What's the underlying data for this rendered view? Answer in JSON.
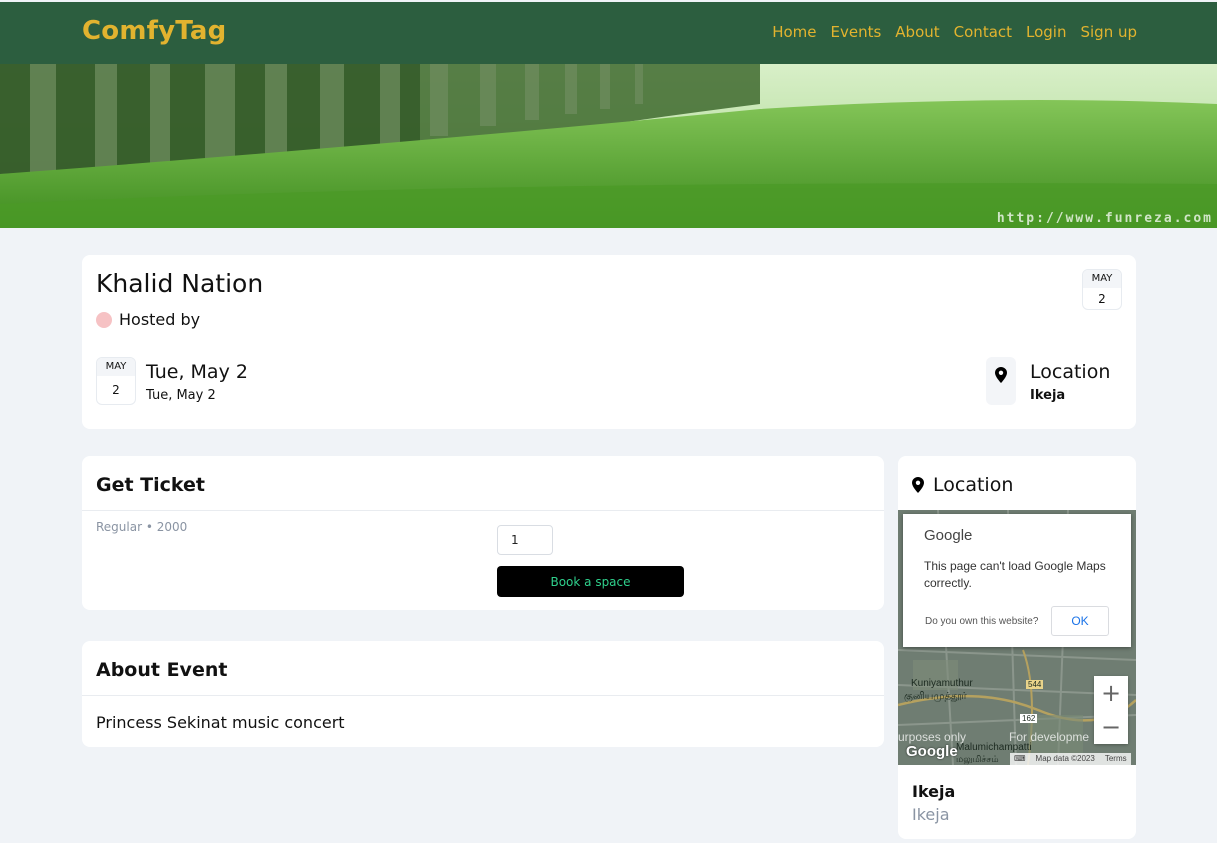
{
  "navbar": {
    "brand": "ComfyTag",
    "links": [
      "Home",
      "Events",
      "About",
      "Contact",
      "Login",
      "Sign up"
    ]
  },
  "banner": {
    "watermark": "http://www.funreza.com"
  },
  "event": {
    "title": "Khalid Nation",
    "hosted_by_label": "Hosted by",
    "badge": {
      "month": "MAY",
      "day": "2"
    },
    "date_badge": {
      "month": "MAY",
      "day": "2"
    },
    "date_main": "Tue, May 2",
    "date_sub": "Tue, May 2",
    "location_title": "Location",
    "location_sub": "Ikeja"
  },
  "ticket": {
    "heading": "Get Ticket",
    "type_label": "Regular • 2000",
    "quantity": "1",
    "book_label": "Book a space"
  },
  "about": {
    "heading": "About Event",
    "text": "Princess Sekinat music concert"
  },
  "location_card": {
    "heading": "Location",
    "place": "Ikeja",
    "place_sub": "Ikeja"
  },
  "map": {
    "dialog_logo": "Google",
    "dialog_message": "This page can't load Google Maps correctly.",
    "dialog_question": "Do you own this website?",
    "dialog_ok": "OK",
    "zoom_in": "+",
    "zoom_out": "−",
    "labels": {
      "kuniyamuthur": "Kuniyamuthur",
      "kuniyamuthur_ta": "குனியமுத்தூர்",
      "road_544": "544",
      "road_162": "162",
      "malumichampatti": "Malumichampatti",
      "malumichampatti_ta": "மலுமிச்சம்"
    },
    "watermark_left": "urposes only",
    "watermark_right": "For developme",
    "wordmark": "Google",
    "attribution": "Map data ©2023",
    "terms": "Terms"
  },
  "colors": {
    "navbar": "#2c5e3f",
    "brand": "#e2b32f",
    "book_button_text": "#2fd08c",
    "host_dot": "#f6c2c4",
    "muted_text": "#8a94a3"
  }
}
